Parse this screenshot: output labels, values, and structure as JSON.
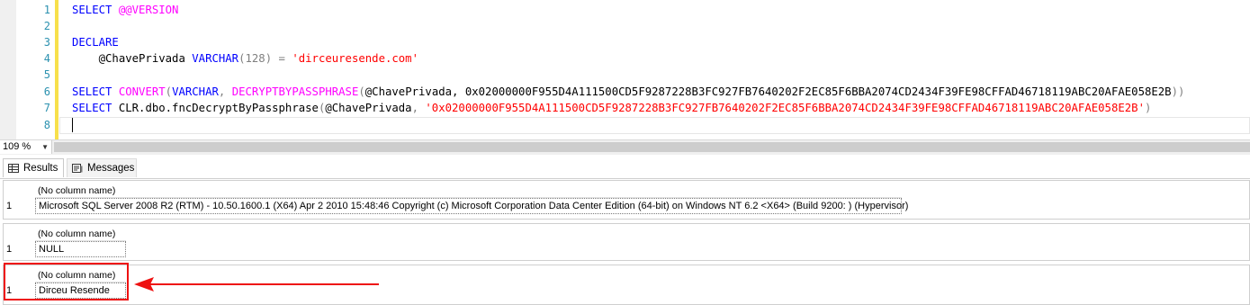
{
  "editor": {
    "line_numbers": [
      "1",
      "2",
      "3",
      "4",
      "5",
      "6",
      "7",
      "8"
    ],
    "lines": [
      [
        {
          "t": "SELECT",
          "c": "kw"
        },
        {
          "t": " ",
          "c": "blk"
        },
        {
          "t": "@@VERSION",
          "c": "fn"
        }
      ],
      [],
      [
        {
          "t": "DECLARE",
          "c": "kw"
        }
      ],
      [
        {
          "t": "    @ChavePrivada ",
          "c": "blk"
        },
        {
          "t": "VARCHAR",
          "c": "kw"
        },
        {
          "t": "(128) ",
          "c": "gr"
        },
        {
          "t": "= ",
          "c": "gr"
        },
        {
          "t": "'dirceuresende.com'",
          "c": "str"
        }
      ],
      [],
      [
        {
          "t": "SELECT ",
          "c": "kw"
        },
        {
          "t": "CONVERT",
          "c": "fn"
        },
        {
          "t": "(",
          "c": "gr"
        },
        {
          "t": "VARCHAR",
          "c": "kw"
        },
        {
          "t": ", ",
          "c": "gr"
        },
        {
          "t": "DECRYPTBYPASSPHRASE",
          "c": "fn"
        },
        {
          "t": "(",
          "c": "gr"
        },
        {
          "t": "@ChavePrivada, 0x02000000F955D4A111500CD5F9287228B3FC927FB7640202F2EC85F6BBA2074CD2434F39FE98CFFAD46718119ABC20AFAE058E2B",
          "c": "blk"
        },
        {
          "t": "))",
          "c": "gr"
        }
      ],
      [
        {
          "t": "SELECT ",
          "c": "kw"
        },
        {
          "t": "CLR.dbo.fncDecryptByPassphrase",
          "c": "blk"
        },
        {
          "t": "(",
          "c": "gr"
        },
        {
          "t": "@ChavePrivada",
          "c": "blk"
        },
        {
          "t": ", ",
          "c": "gr"
        },
        {
          "t": "'0x02000000F955D4A111500CD5F9287228B3FC927FB7640202F2EC85F6BBA2074CD2434F39FE98CFFAD46718119ABC20AFAE058E2B'",
          "c": "str"
        },
        {
          "t": ")",
          "c": "gr"
        }
      ],
      []
    ]
  },
  "zoom": {
    "value": "109 %"
  },
  "tabs": {
    "results": "Results",
    "messages": "Messages"
  },
  "results": [
    {
      "header": "(No column name)",
      "row_number": "1",
      "value": "Microsoft SQL Server 2008 R2 (RTM) - 10.50.1600.1 (X64)   Apr  2 2010 15:48:46   Copyright (c) Microsoft Corporation  Data Center Edition (64-bit) on Windows NT 6.2 <X64> (Build 9200: ) (Hypervisor)"
    },
    {
      "header": "(No column name)",
      "row_number": "1",
      "value": "NULL"
    },
    {
      "header": "(No column name)",
      "row_number": "1",
      "value": "Dirceu Resende"
    }
  ],
  "colors": {
    "annotation": "#ee1111",
    "keyword": "#0000ff",
    "function": "#ff00ff",
    "string": "#ff0000",
    "line_number": "#2b91af"
  }
}
